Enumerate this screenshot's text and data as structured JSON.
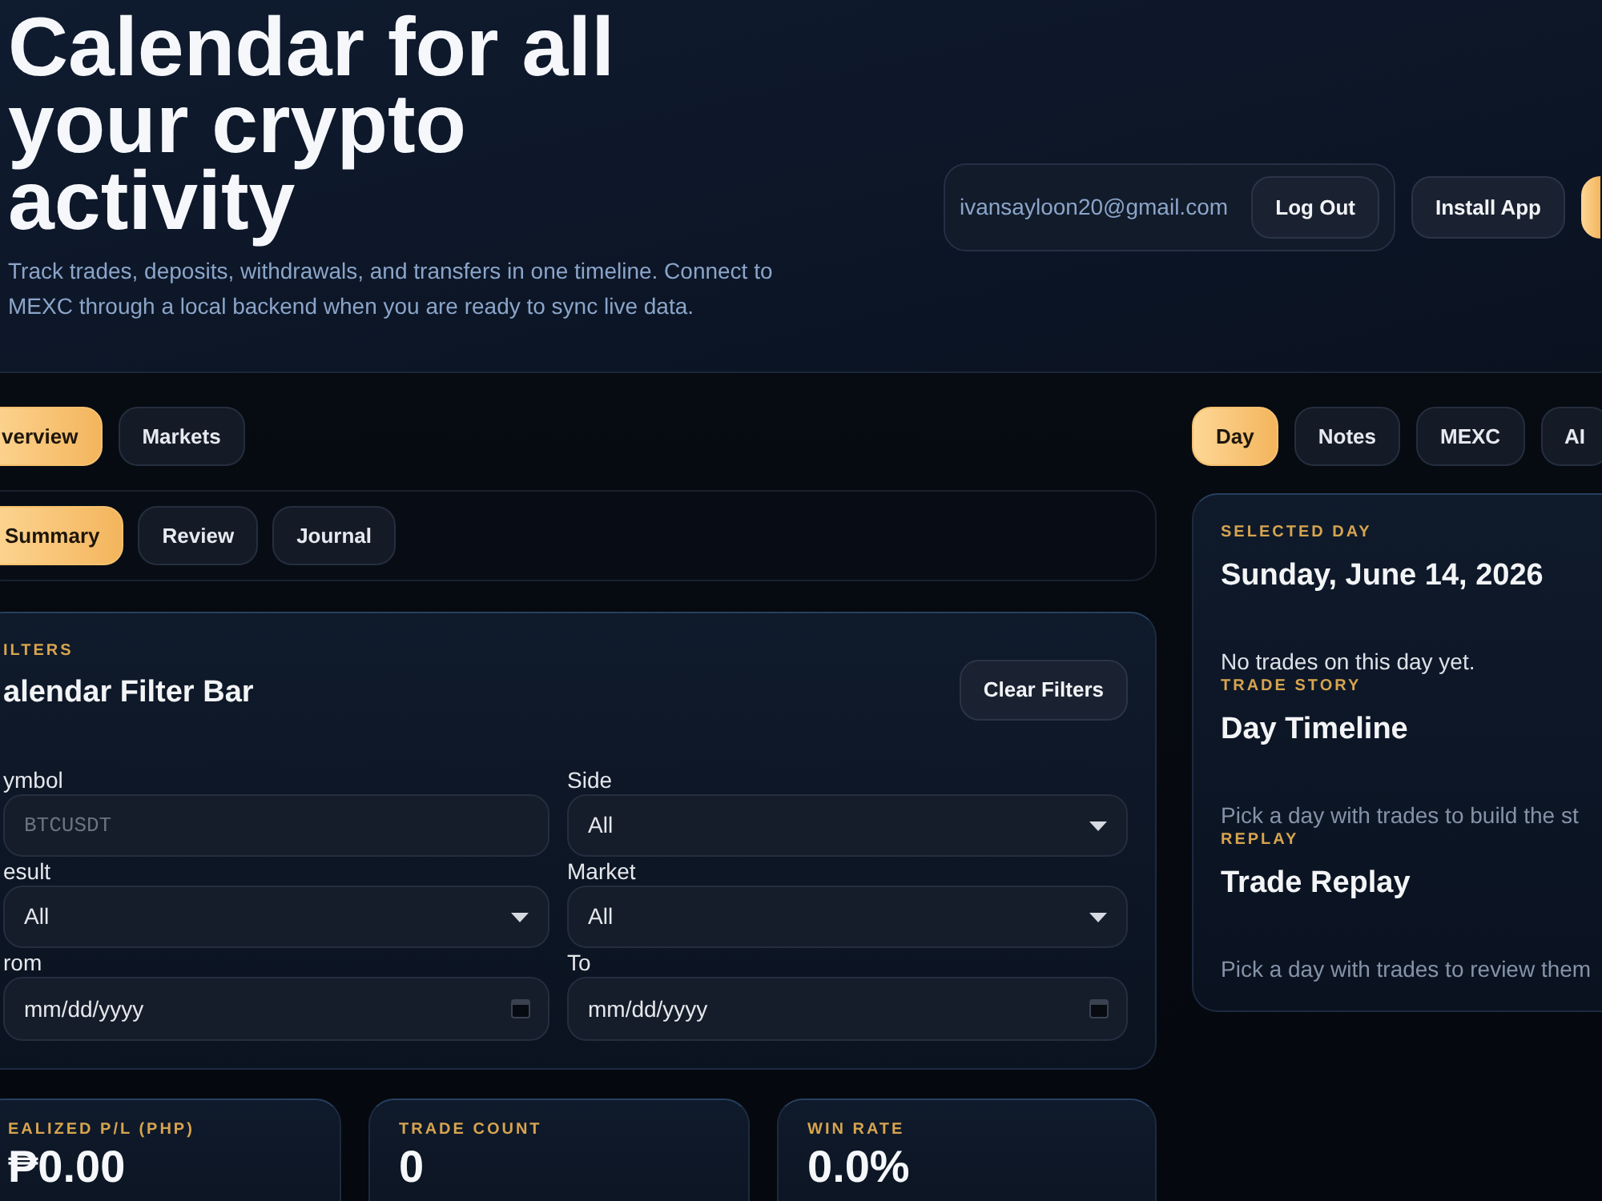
{
  "header": {
    "headline": "Calendar for all your crypto activity",
    "description": "Track trades, deposits, withdrawals, and transfers in one timeline. Connect to MEXC through a local backend when you are ready to sync live data.",
    "account": {
      "email": "ivansayloon20@gmail.com",
      "logout": "Log Out"
    },
    "install": "Install App"
  },
  "main_tabs": [
    {
      "label": "verview",
      "selected": true
    },
    {
      "label": "Markets",
      "selected": false
    }
  ],
  "sub_tabs": [
    {
      "label": "Summary",
      "selected": true
    },
    {
      "label": "Review",
      "selected": false
    },
    {
      "label": "Journal",
      "selected": false
    }
  ],
  "filters": {
    "eyebrow": "ILTERS",
    "title": "alendar Filter Bar",
    "clear_button": "Clear Filters",
    "fields": [
      {
        "label": "ymbol",
        "kind": "text",
        "placeholder": "BTCUSDT"
      },
      {
        "label": "Side",
        "kind": "select",
        "value": "All"
      },
      {
        "label": "esult",
        "kind": "select",
        "value": "All"
      },
      {
        "label": "Market",
        "kind": "select",
        "value": "All"
      },
      {
        "label": "rom",
        "kind": "date",
        "placeholder": "mm/dd/yyyy"
      },
      {
        "label": "To",
        "kind": "date",
        "placeholder": "mm/dd/yyyy"
      }
    ]
  },
  "stats": [
    {
      "label": "EALIZED P/L (PHP)",
      "value": "₱0.00"
    },
    {
      "label": "TRADE COUNT",
      "value": "0"
    },
    {
      "label": "WIN RATE",
      "value": "0.0%"
    }
  ],
  "side_tabs": [
    {
      "label": "Day",
      "selected": true
    },
    {
      "label": "Notes",
      "selected": false
    },
    {
      "label": "MEXC",
      "selected": false
    },
    {
      "label": "AI",
      "selected": false
    }
  ],
  "day_panel": {
    "sections": [
      {
        "eyebrow": "SELECTED DAY",
        "title": "Sunday, June 14, 2026",
        "text": "No trades on this day yet.",
        "text_muted": false
      },
      {
        "eyebrow": "TRADE STORY",
        "title": "Day Timeline",
        "text": "Pick a day with trades to build the st",
        "text_muted": true
      },
      {
        "eyebrow": "REPLAY",
        "title": "Trade Replay",
        "text": "Pick a day with trades to review them",
        "text_muted": true
      }
    ]
  }
}
